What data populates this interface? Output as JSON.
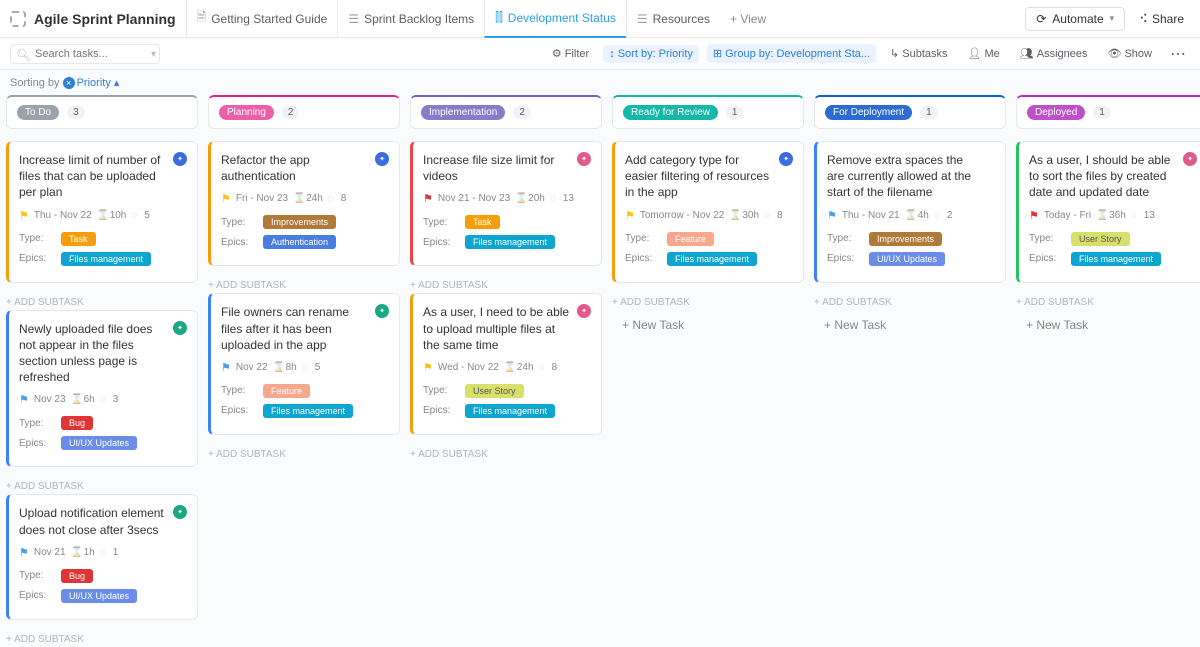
{
  "header": {
    "title": "Agile Sprint Planning",
    "tabs": [
      {
        "label": "Getting Started Guide"
      },
      {
        "label": "Sprint Backlog Items"
      },
      {
        "label": "Development Status",
        "active": true
      },
      {
        "label": "Resources"
      }
    ],
    "add_view": "+ View",
    "automate": "Automate",
    "share": "Share"
  },
  "toolbar": {
    "search_placeholder": "Search tasks...",
    "filter": "Filter",
    "sort": "Sort by: Priority",
    "group": "Group by: Development Sta...",
    "subtasks": "Subtasks",
    "me": "Me",
    "assignees": "Assignees",
    "show": "Show"
  },
  "sorting": {
    "label": "Sorting by",
    "value": "Priority"
  },
  "labels": {
    "type": "Type:",
    "epics": "Epics:",
    "add_subtask": "+ ADD SUBTASK",
    "new_task": "+ New Task"
  },
  "columns": [
    {
      "name": "To Do",
      "count": "3",
      "pill": "p-gray",
      "bc": "bc-gray"
    },
    {
      "name": "Planning",
      "count": "2",
      "pill": "p-pink",
      "bc": "bc-pink"
    },
    {
      "name": "Implementation",
      "count": "2",
      "pill": "p-purple",
      "bc": "bc-purple"
    },
    {
      "name": "Ready for Review",
      "count": "1",
      "pill": "p-teal",
      "bc": "bc-teal"
    },
    {
      "name": "For Deployment",
      "count": "1",
      "pill": "p-blue",
      "bc": "bc-blue"
    },
    {
      "name": "Deployed",
      "count": "1",
      "pill": "p-magenta",
      "bc": "bc-magenta"
    }
  ],
  "cards": {
    "c0": [
      {
        "title": "Increase limit of number of files that can be uploaded per plan",
        "bl": "bl-orange",
        "av": "av-blue",
        "flag": "flag-yellow",
        "date": "Thu  -  Nov 22",
        "est": "10h",
        "cnt": "5",
        "type": "Task",
        "tp": "pill-task",
        "epic": "Files management",
        "ep": "pill-fm"
      },
      {
        "title": "Newly uploaded file does not appear in the files section unless page is refreshed",
        "bl": "bl-blue",
        "av": "av-teal",
        "flag": "flag-blue",
        "date": "Nov 23",
        "est": "6h",
        "cnt": "3",
        "type": "Bug",
        "tp": "pill-bug",
        "epic": "UI/UX Updates",
        "ep": "pill-uiux"
      },
      {
        "title": "Upload notification element does not close after 3secs",
        "bl": "bl-blue",
        "av": "av-teal",
        "flag": "flag-blue",
        "date": "Nov 21",
        "est": "1h",
        "cnt": "1",
        "type": "Bug",
        "tp": "pill-bug",
        "epic": "UI/UX Updates",
        "ep": "pill-uiux"
      }
    ],
    "c1": [
      {
        "title": "Refactor the app authentication",
        "bl": "bl-orange",
        "av": "av-blue",
        "flag": "flag-yellow",
        "date": "Fri  -  Nov 23",
        "est": "24h",
        "cnt": "8",
        "type": "Improvements",
        "tp": "pill-improve",
        "epic": "Authentication",
        "ep": "pill-auth"
      },
      {
        "title": "File owners can rename files after it has been uploaded in the app",
        "bl": "bl-blue",
        "av": "av-teal",
        "flag": "flag-blue",
        "date": "Nov 22",
        "est": "8h",
        "cnt": "5",
        "type": "Feature",
        "tp": "pill-feature",
        "epic": "Files management",
        "ep": "pill-fm"
      }
    ],
    "c2": [
      {
        "title": "Increase file size limit for videos",
        "bl": "bl-red",
        "av": "av-pink",
        "flag": "flag-red",
        "date": "Nov 21  -  Nov 23",
        "est": "20h",
        "cnt": "13",
        "type": "Task",
        "tp": "pill-task",
        "epic": "Files management",
        "ep": "pill-fm"
      },
      {
        "title": "As a user, I need to be able to upload multiple files at the same time",
        "bl": "bl-orange",
        "av": "av-pink",
        "flag": "flag-yellow",
        "date": "Wed  -  Nov 22",
        "est": "24h",
        "cnt": "8",
        "type": "User Story",
        "tp": "pill-story",
        "epic": "Files management",
        "ep": "pill-fm"
      }
    ],
    "c3": [
      {
        "title": "Add category type for easier filtering of resources in the app",
        "bl": "bl-orange",
        "av": "av-blue",
        "flag": "flag-yellow",
        "date": "Tomorrow  -  Nov 22",
        "est": "30h",
        "cnt": "8",
        "type": "Feature",
        "tp": "pill-feature",
        "epic": "Files management",
        "ep": "pill-fm"
      }
    ],
    "c4": [
      {
        "title": "Remove extra spaces the are currently allowed at the start of the filename",
        "bl": "bl-blue",
        "av": "",
        "flag": "flag-blue",
        "date": "Thu  -  Nov 21",
        "est": "4h",
        "cnt": "2",
        "type": "Improvements",
        "tp": "pill-improve",
        "epic": "UI/UX Updates",
        "ep": "pill-uiux"
      }
    ],
    "c5": [
      {
        "title": "As a user, I should be able to sort the files by created date and updated date",
        "bl": "bl-green",
        "av": "av-pink",
        "flag": "flag-red",
        "date": "Today  -  Fri",
        "est": "36h",
        "cnt": "13",
        "type": "User Story",
        "tp": "pill-story",
        "epic": "Files management",
        "ep": "pill-fm"
      }
    ]
  }
}
